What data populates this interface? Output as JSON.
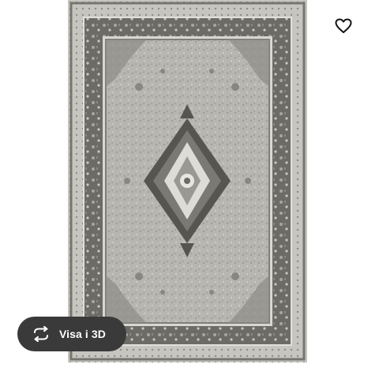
{
  "product": {
    "image_icon": "rug-image",
    "colors": {
      "field": "#b7b6b1",
      "border": "#6d6b66",
      "dark": "#575550",
      "light": "#dedcd7"
    }
  },
  "favorite": {
    "icon": "heart-outline-icon"
  },
  "view_3d": {
    "label": "Visa i 3D",
    "icon": "rotate-3d-icon",
    "background": "#3a3a3a"
  }
}
